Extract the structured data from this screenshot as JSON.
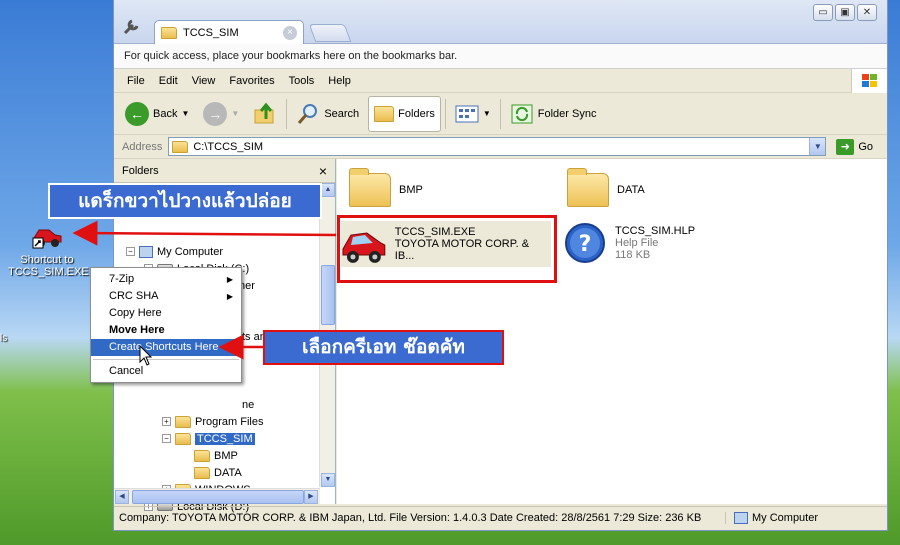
{
  "desktop": {
    "shortcut_label_1": "Shortcut to",
    "shortcut_label_2": "TCCS_SIM.EXE",
    "edge_label": "ls"
  },
  "browser": {
    "tab_title": "TCCS_SIM",
    "tab_close": "×",
    "bookmarks_hint": "For quick access, place your bookmarks here on the bookmarks bar.",
    "min_btn": "▭",
    "restore_btn": "▣",
    "close_btn": "✕"
  },
  "menubar": [
    "File",
    "Edit",
    "View",
    "Favorites",
    "Tools",
    "Help"
  ],
  "toolbar": {
    "back": "Back",
    "search": "Search",
    "folders": "Folders",
    "folder_sync": "Folder Sync"
  },
  "address": {
    "label": "Address",
    "path": "C:\\TCCS_SIM",
    "go": "Go"
  },
  "folders_pane": {
    "title": "Folders",
    "close": "×",
    "tree": {
      "my_computer": "My Computer",
      "local_c": "Local Disk (C:)",
      "adwcleaner": "AdwCleaner",
      "docs_settings_partial": "ts and Settings",
      "home_partial": "ne",
      "program_files": "Program Files",
      "tccs_sim": "TCCS_SIM",
      "bmp": "BMP",
      "data": "DATA",
      "windows": "WINDOWS",
      "local_d": "Local Disk (D:)"
    }
  },
  "files": {
    "bmp": "BMP",
    "data": "DATA",
    "exe_name": "TCCS_SIM.EXE",
    "exe_company": "TOYOTA MOTOR CORP. & IB...",
    "hlp_name": "TCCS_SIM.HLP",
    "hlp_type": "Help File",
    "hlp_size": "118 KB"
  },
  "status": {
    "info": "Company: TOYOTA MOTOR CORP. & IBM Japan, Ltd. File Version: 1.4.0.3 Date Created: 28/8/2561 7:29 Size: 236 KB",
    "location": "My Computer"
  },
  "context_menu": {
    "zip": "7-Zip",
    "crc": "CRC SHA",
    "copy_here": "Copy Here",
    "move_here": "Move Here",
    "create_shortcuts": "Create Shortcuts Here",
    "cancel": "Cancel"
  },
  "callouts": {
    "drag_drop": "แดร็กขวาไปวางแล้วปล่อย",
    "create_shortcut": "เลือกครีเอท ช๊อตคัท"
  },
  "colors": {
    "callout_bg": "#3b6bd0",
    "callout_border": "#e01010",
    "selection": "#316ac5"
  }
}
